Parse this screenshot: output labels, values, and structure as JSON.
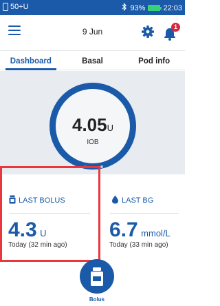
{
  "status_bar": {
    "pod_status": "50+U",
    "battery": "93%",
    "time": "22:03"
  },
  "header": {
    "date": "9 Jun",
    "notification_count": "1"
  },
  "tabs": [
    {
      "label": "Dashboard",
      "active": true
    },
    {
      "label": "Basal",
      "active": false
    },
    {
      "label": "Pod info",
      "active": false
    }
  ],
  "iob": {
    "value": "4.05",
    "unit": "U",
    "label": "IOB"
  },
  "carousel": {
    "pages": 2,
    "active_page": 1
  },
  "last_bolus": {
    "title": "LAST BOLUS",
    "value": "4.3",
    "unit": "U",
    "time": "Today (32 min ago)"
  },
  "last_bg": {
    "title": "LAST BG",
    "value": "6.7",
    "unit": "mmol/L",
    "time": "Today (33 min ago)"
  },
  "bolus_button": {
    "label": "Bolus"
  },
  "colors": {
    "accent": "#1a5aa8",
    "status_bar": "#1a5aa8",
    "highlight": "#e8383d",
    "battery": "#38d17a",
    "badge": "#d7263d"
  }
}
